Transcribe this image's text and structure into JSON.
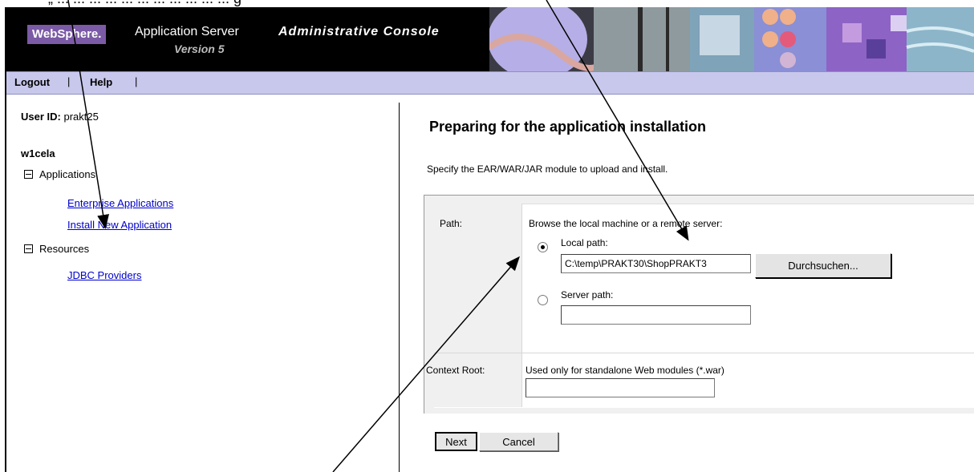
{
  "banner": {
    "logo": "WebSphere.",
    "product": "Application Server",
    "version": "Version 5",
    "console": "Administrative Console"
  },
  "nav": {
    "logout": "Logout",
    "help": "Help",
    "separator": "|"
  },
  "sidebar": {
    "user_label": "User ID:",
    "user_value": "prakt25",
    "node": "w1cela",
    "applications": "Applications",
    "enterprise_apps": "Enterprise Applications",
    "install_new": "Install New Application",
    "resources": "Resources",
    "jdbc": "JDBC Providers"
  },
  "main": {
    "title": "Preparing for the application installation",
    "description": "Specify the EAR/WAR/JAR module to upload and install.",
    "path_label": "Path:",
    "browse_text": "Browse the local machine or a remote server:",
    "local_path_label": "Local path:",
    "local_path_value": "C:\\temp\\PRAKT30\\ShopPRAKT3",
    "browse_button": "Durchsuchen...",
    "server_path_label": "Server path:",
    "server_path_value": "",
    "context_root_label": "Context Root:",
    "context_root_hint": "Used only for standalone Web modules (*.war)",
    "context_root_value": "",
    "next_button": "Next",
    "cancel_button": "Cancel"
  },
  "colors": {
    "banner": "#000000",
    "navbar": "#c8c8ec",
    "logo": "#7b5aa6",
    "link": "#0000cc"
  }
}
